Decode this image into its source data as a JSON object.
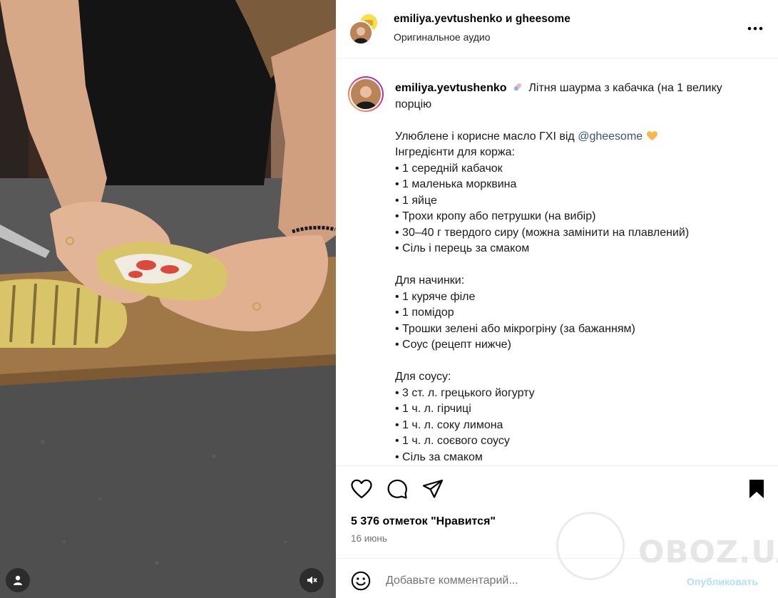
{
  "header": {
    "names": "emiliya.yevtushenko и gheesome",
    "audio": "Оригинальное аудио",
    "more_icon": "more-horizontal-icon"
  },
  "caption": {
    "username": "emiliya.yevtushenko",
    "lines": [
      "Літня шаурма з кабачка (на 1 велику",
      "порцію",
      "",
      "Улюблене і корисне масло ГХІ від ",
      "Інгредієнти для коржа:",
      "• 1 середній кабачок",
      "• 1 маленька морквина",
      "• 1 яйце",
      "• Трохи кропу або петрушки (на вибір)",
      "• 30–40 г твердого сиру (можна замінити на плавлений)",
      "• Сіль і перець за смаком",
      "",
      "Для начинки:",
      "• 1 куряче філе",
      "• 1 помідор",
      "• Трошки зелені або мікрогріну (за бажанням)",
      "• Соус (рецепт нижче)",
      "",
      "Для соусу:",
      "• 3 ст. л. грецького йогурту",
      "• 1 ч. л. гірчиці",
      "• 1 ч. л. соку лимона",
      "• 1 ч. л. соєвого соусу",
      "• Сіль за смаком"
    ],
    "mention": "@gheesome"
  },
  "actions": {
    "likes": "5 376 отметок \"Нравится\"",
    "date": "16 июнь"
  },
  "comment_bar": {
    "placeholder": "Добавьте комментарий...",
    "post_label": "Опубликовать"
  },
  "watermark": {
    "text": "OBOZ.UA"
  },
  "colors": {
    "link": "#385185",
    "muted": "#737373",
    "post_disabled": "#b2dffc",
    "border": "#efefef"
  }
}
